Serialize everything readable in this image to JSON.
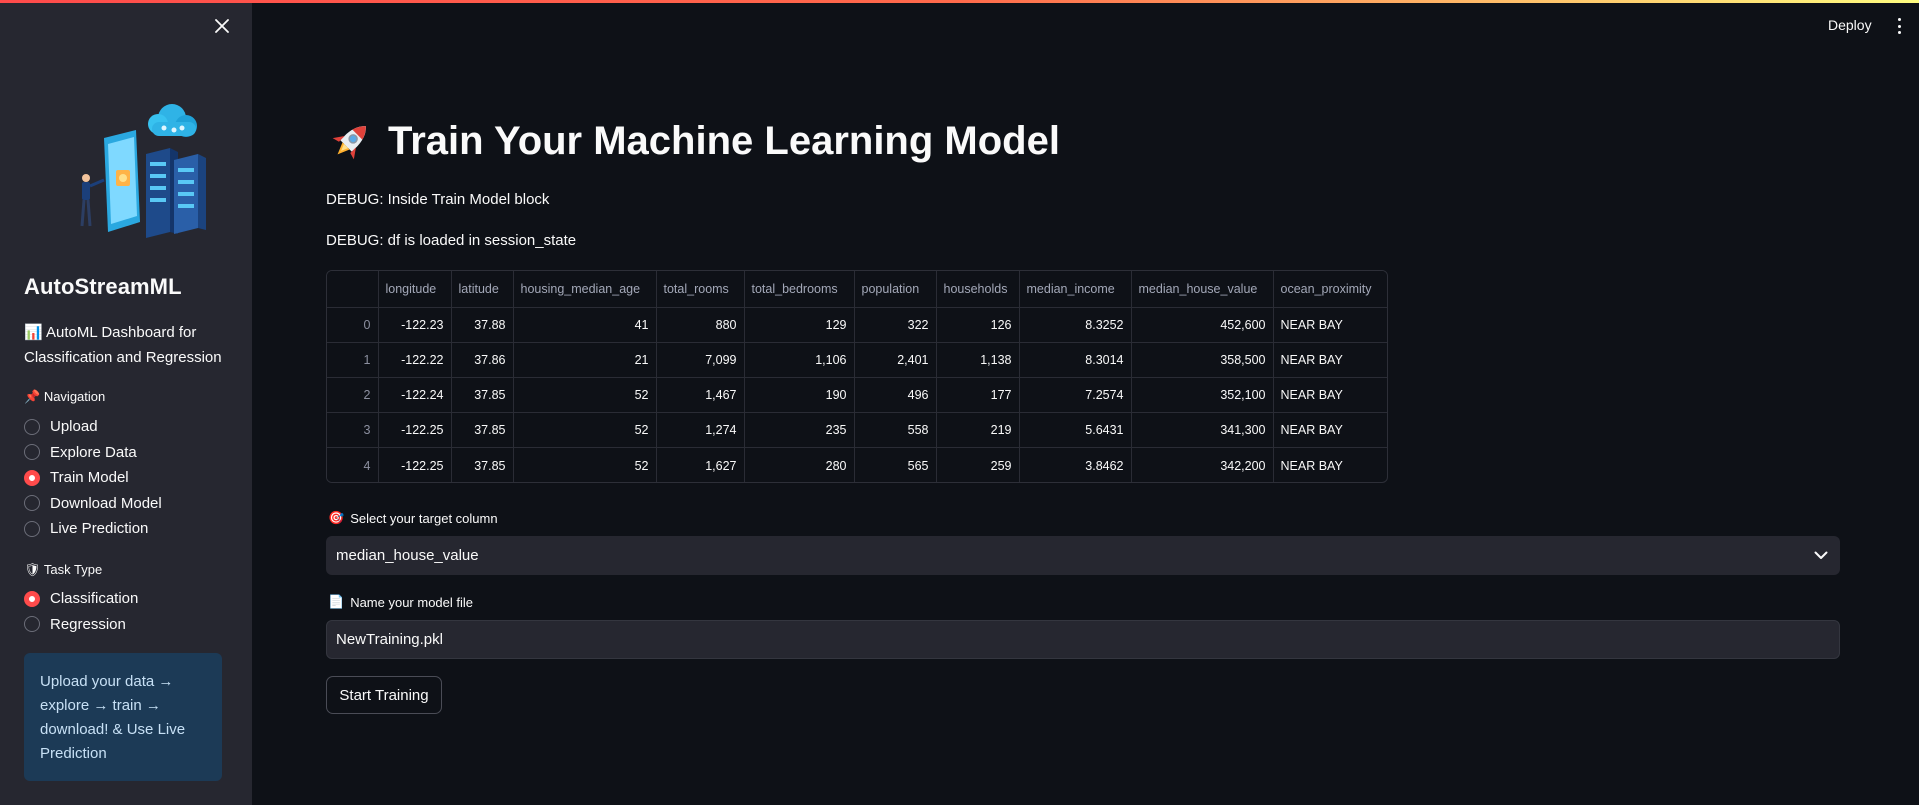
{
  "header": {
    "deploy_label": "Deploy",
    "menu_icon": "kebab-menu-icon"
  },
  "sidebar": {
    "close_icon": "close-icon",
    "app_title": "AutoStreamML",
    "description_icon": "📊",
    "description": "AutoML Dashboard for Classification and Regression",
    "navigation": {
      "icon": "📌",
      "label": "Navigation",
      "options": [
        {
          "label": "Upload",
          "selected": false
        },
        {
          "label": "Explore Data",
          "selected": false
        },
        {
          "label": "Train Model",
          "selected": true
        },
        {
          "label": "Download Model",
          "selected": false
        },
        {
          "label": "Live Prediction",
          "selected": false
        }
      ]
    },
    "task_type": {
      "icon": "🛡",
      "label": "Task Type",
      "options": [
        {
          "label": "Classification",
          "selected": true
        },
        {
          "label": "Regression",
          "selected": false
        }
      ]
    },
    "info_box": "Upload your data → explore → train → download! & Use Live Prediction"
  },
  "main": {
    "title_icon": "rocket-icon",
    "title": "Train Your Machine Learning Model",
    "debug_lines": [
      "DEBUG: Inside Train Model block",
      "DEBUG: df is loaded in session_state"
    ],
    "table": {
      "columns": [
        "",
        "longitude",
        "latitude",
        "housing_median_age",
        "total_rooms",
        "total_bedrooms",
        "population",
        "households",
        "median_income",
        "median_house_value",
        "ocean_proximity"
      ],
      "rows": [
        [
          "0",
          "-122.23",
          "37.88",
          "41",
          "880",
          "129",
          "322",
          "126",
          "8.3252",
          "452,600",
          "NEAR BAY"
        ],
        [
          "1",
          "-122.22",
          "37.86",
          "21",
          "7,099",
          "1,106",
          "2,401",
          "1,138",
          "8.3014",
          "358,500",
          "NEAR BAY"
        ],
        [
          "2",
          "-122.24",
          "37.85",
          "52",
          "1,467",
          "190",
          "496",
          "177",
          "7.2574",
          "352,100",
          "NEAR BAY"
        ],
        [
          "3",
          "-122.25",
          "37.85",
          "52",
          "1,274",
          "235",
          "558",
          "219",
          "5.6431",
          "341,300",
          "NEAR BAY"
        ],
        [
          "4",
          "-122.25",
          "37.85",
          "52",
          "1,627",
          "280",
          "565",
          "259",
          "3.8462",
          "342,200",
          "NEAR BAY"
        ]
      ]
    },
    "target": {
      "icon": "🎯",
      "label": "Select your target column",
      "value": "median_house_value"
    },
    "model_file": {
      "icon": "📄",
      "label": "Name your model file",
      "value": "NewTraining.pkl"
    },
    "start_button": "Start Training"
  },
  "colors": {
    "accent": "#ff4b4b",
    "background": "#0e1117",
    "sidebar": "#262730",
    "info_box": "#1c3a56",
    "info_text": "#c7e0f5"
  }
}
